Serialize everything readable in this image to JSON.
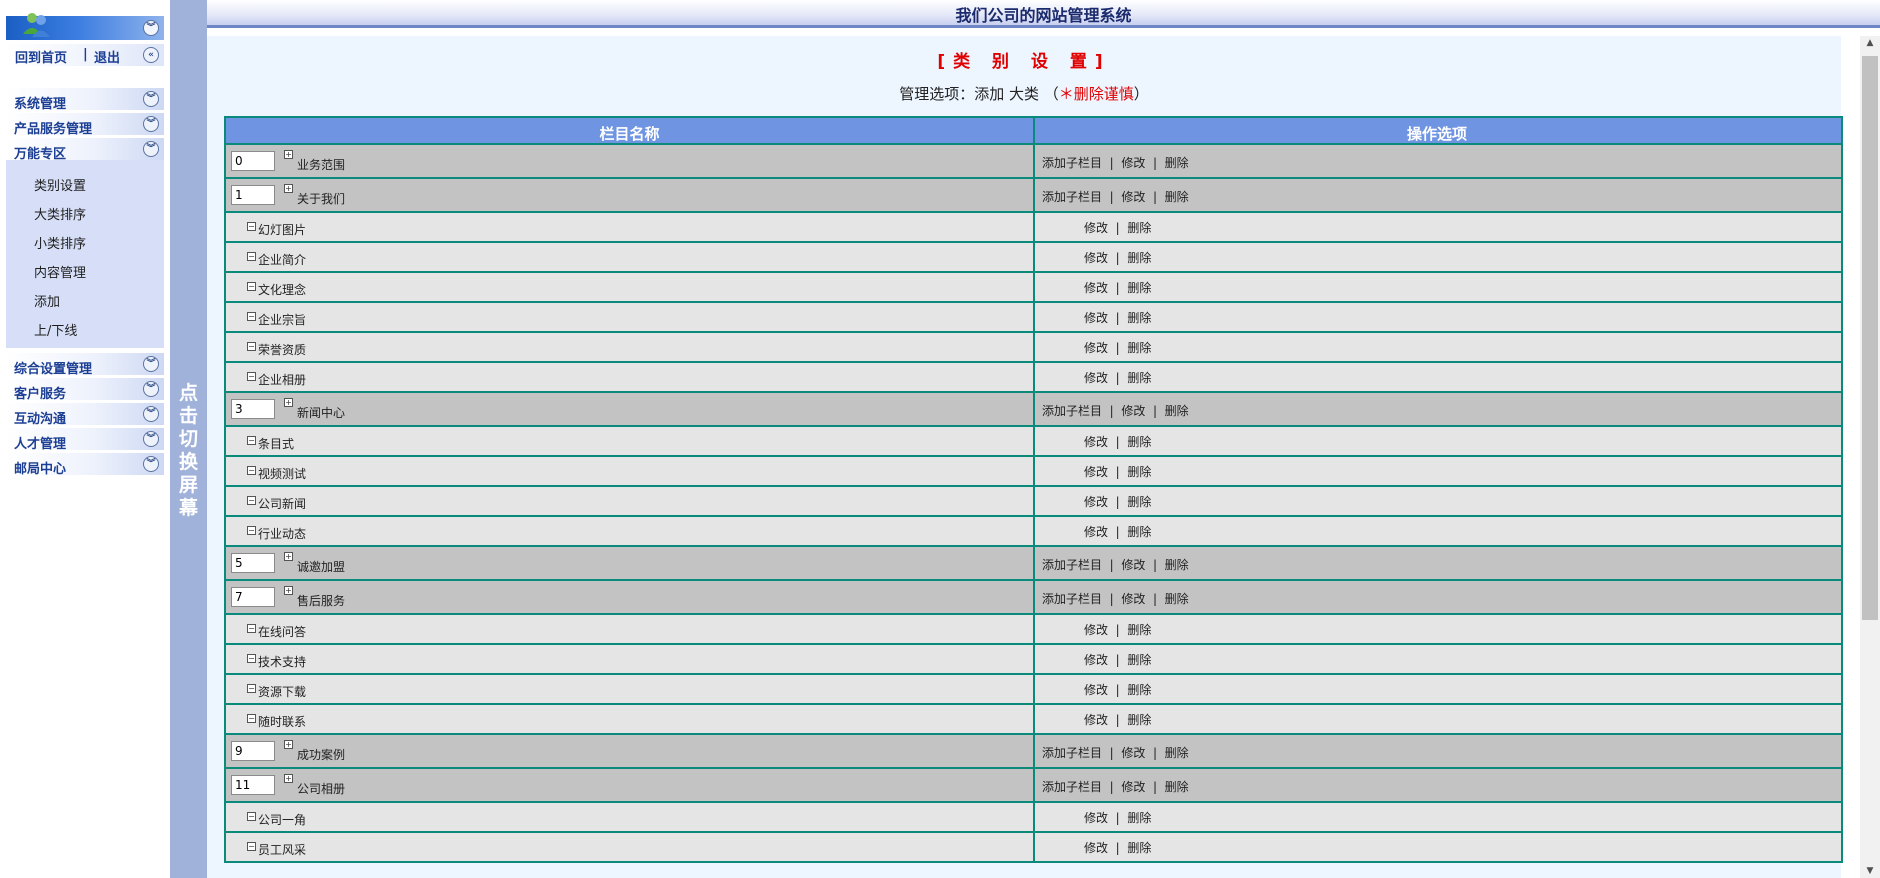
{
  "app_title": "我们公司的网站管理系统",
  "sidebar": {
    "home_link": "回到首页",
    "link_separator": "|",
    "logout_link": "退出",
    "sections": [
      {
        "label": "系统管理"
      },
      {
        "label": "产品服务管理"
      },
      {
        "label": "万能专区"
      },
      {
        "label": "综合设置管理"
      },
      {
        "label": "客户服务"
      },
      {
        "label": "互动沟通"
      },
      {
        "label": "人才管理"
      },
      {
        "label": "邮局中心"
      }
    ],
    "submenu": [
      "类别设置",
      "大类排序",
      "小类排序",
      "内容管理",
      "添加",
      "上/下线"
    ]
  },
  "split_bar": {
    "label": "点击切换屏幕"
  },
  "page": {
    "heading": "[类 别 设 置]",
    "options_prefix": "管理选项：",
    "option_add": "添加 大类",
    "option_paren_open": " （",
    "option_warn": "＊删除谨慎",
    "option_paren_close": "）"
  },
  "table": {
    "col_name": "栏目名称",
    "col_ops": "操作选项",
    "op_add_child": "添加子栏目",
    "op_edit": "修改",
    "op_delete": "删除",
    "op_sep": "|",
    "rows": [
      {
        "level": "big",
        "order": "0",
        "name": "业务范围"
      },
      {
        "level": "big",
        "order": "1",
        "name": "关于我们"
      },
      {
        "level": "small",
        "name": "幻灯图片"
      },
      {
        "level": "small",
        "name": "企业简介"
      },
      {
        "level": "small",
        "name": "文化理念"
      },
      {
        "level": "small",
        "name": "企业宗旨"
      },
      {
        "level": "small",
        "name": "荣誉资质"
      },
      {
        "level": "small",
        "name": "企业相册"
      },
      {
        "level": "big",
        "order": "3",
        "name": "新闻中心"
      },
      {
        "level": "small",
        "name": "条目式"
      },
      {
        "level": "small",
        "name": "视频测试"
      },
      {
        "level": "small",
        "name": "公司新闻"
      },
      {
        "level": "small",
        "name": "行业动态"
      },
      {
        "level": "big",
        "order": "5",
        "name": "诚邀加盟"
      },
      {
        "level": "big",
        "order": "7",
        "name": "售后服务"
      },
      {
        "level": "small",
        "name": "在线问答"
      },
      {
        "level": "small",
        "name": "技术支持"
      },
      {
        "level": "small",
        "name": "资源下载"
      },
      {
        "level": "small",
        "name": "随时联系"
      },
      {
        "level": "big",
        "order": "9",
        "name": "成功案例"
      },
      {
        "level": "big",
        "order": "11",
        "name": "公司相册"
      },
      {
        "level": "small",
        "name": "公司一角"
      },
      {
        "level": "small",
        "name": "员工风采"
      }
    ]
  },
  "colors": {
    "header_bg": "#6f95e2",
    "border": "#0a8a7a",
    "big_row_bg": "#c3c3c3",
    "small_row_bg": "#e5e5e5",
    "warn": "#e00000",
    "link": "#1c3f94"
  },
  "icons": {
    "collapse": "chevron-double-down-icon",
    "expand": "chevron-double-left-icon",
    "plus": "plus-box-icon",
    "minus": "minus-box-icon"
  }
}
